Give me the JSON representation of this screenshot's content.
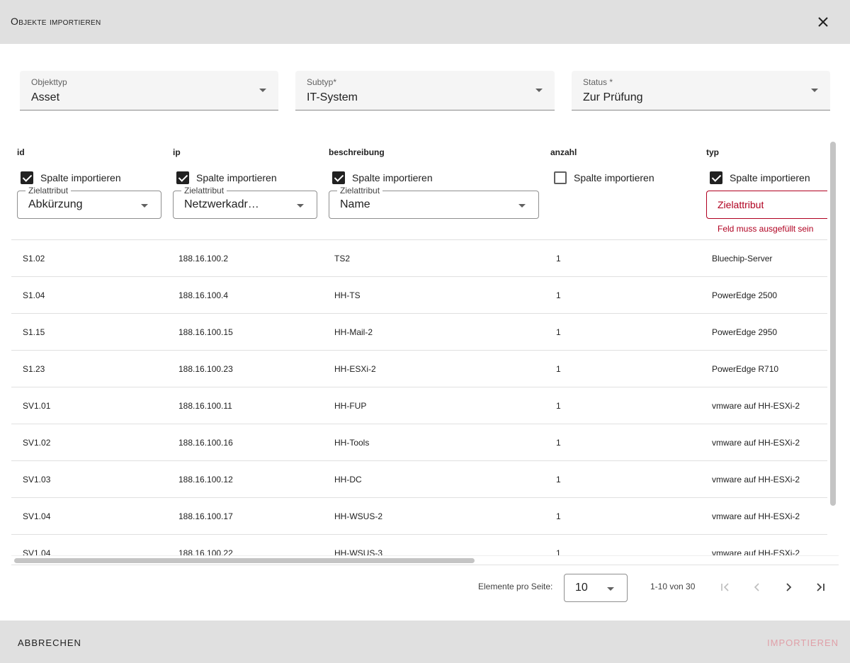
{
  "dialog": {
    "title": "Objekte importieren",
    "close_icon": "close-icon"
  },
  "filters": {
    "objekttyp": {
      "label": "Objekttyp",
      "value": "Asset"
    },
    "subtyp": {
      "label": "Subtyp*",
      "value": "IT-System"
    },
    "status": {
      "label": "Status *",
      "value": "Zur Prüfung"
    }
  },
  "columns": [
    {
      "key": "id",
      "import_label": "Spalte importieren",
      "checked": true,
      "target_label": "Zielattribut",
      "target_value": "Abkürzung",
      "error": ""
    },
    {
      "key": "ip",
      "import_label": "Spalte importieren",
      "checked": true,
      "target_label": "Zielattribut",
      "target_value": "Netzwerkadr…",
      "error": ""
    },
    {
      "key": "beschreibung",
      "import_label": "Spalte importieren",
      "checked": true,
      "target_label": "Zielattribut",
      "target_value": "Name",
      "error": ""
    },
    {
      "key": "anzahl",
      "import_label": "Spalte importieren",
      "checked": false,
      "target_label": "",
      "target_value": "",
      "error": ""
    },
    {
      "key": "typ",
      "import_label": "Spalte importieren",
      "checked": true,
      "target_label": "",
      "target_value": "Zielattribut",
      "error": "Feld muss ausgefüllt sein"
    }
  ],
  "rows": [
    [
      "S1.02",
      "188.16.100.2",
      "TS2",
      "1",
      "Bluechip-Server"
    ],
    [
      "S1.04",
      "188.16.100.4",
      "HH-TS",
      "1",
      "PowerEdge 2500"
    ],
    [
      "S1.15",
      "188.16.100.15",
      "HH-Mail-2",
      "1",
      "PowerEdge 2950"
    ],
    [
      "S1.23",
      "188.16.100.23",
      "HH-ESXi-2",
      "1",
      "PowerEdge R710"
    ],
    [
      "SV1.01",
      "188.16.100.11",
      "HH-FUP",
      "1",
      "vmware auf HH-ESXi-2"
    ],
    [
      "SV1.02",
      "188.16.100.16",
      "HH-Tools",
      "1",
      "vmware auf HH-ESXi-2"
    ],
    [
      "SV1.03",
      "188.16.100.12",
      "HH-DC",
      "1",
      "vmware auf HH-ESXi-2"
    ],
    [
      "SV1.04",
      "188.16.100.17",
      "HH-WSUS-2",
      "1",
      "vmware auf HH-ESXi-2"
    ],
    [
      "SV1.04",
      "188.16.100.22",
      "HH-WSUS-3",
      "1",
      "vmware auf HH-ESXi-2"
    ]
  ],
  "paginator": {
    "items_label": "Elemente pro Seite:",
    "page_size": "10",
    "range": "1-10 von 30"
  },
  "footer": {
    "cancel": "ABBRECHEN",
    "import": "IMPORTIEREN"
  },
  "colors": {
    "header_bg": "#e0e0e0",
    "error": "#b00020",
    "import_disabled": "#e0a0a8"
  }
}
